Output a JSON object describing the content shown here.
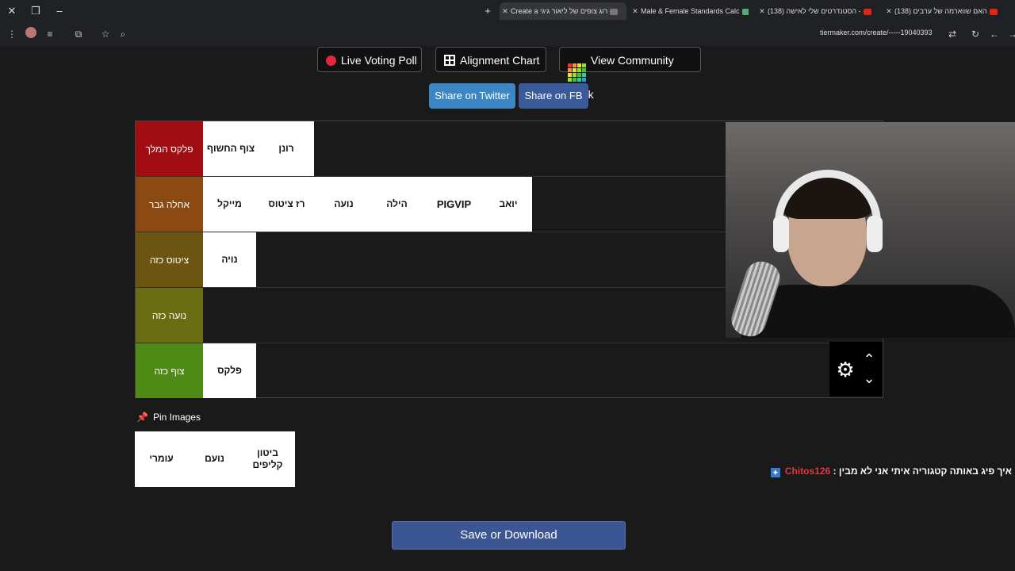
{
  "browser": {
    "tabs": [
      {
        "title": "Create a רוג צופים של ליאור גיגי",
        "active": true
      },
      {
        "title": "Male & Female Standards Calc",
        "active": false
      },
      {
        "title": "(138) הסטנדרטים שלי לאישה -",
        "active": false
      },
      {
        "title": "(138) האם שווארמה של ערבים",
        "active": false
      }
    ],
    "url": "tiermaker.com/create/-----19040393"
  },
  "top_buttons": {
    "live_poll": "Live Voting Poll",
    "alignment": "Alignment Chart",
    "community": "View Community Rank"
  },
  "share": {
    "twitter": "Share on Twitter",
    "fb": "Share on FB"
  },
  "tiers": [
    {
      "label": "פלקס המלך",
      "color": "#a20d12",
      "items": [
        "צוף החשוף",
        "רונן"
      ]
    },
    {
      "label": "אחלה גבר",
      "color": "#8a4a12",
      "items": [
        "מייקל",
        "רז ציטוס",
        "נועה",
        "הילה",
        "PIGVIP",
        "יואב"
      ]
    },
    {
      "label": "ציטוס כזה",
      "color": "#6b5510",
      "items": [
        "נויה"
      ]
    },
    {
      "label": "נועה כזה",
      "color": "#6b6d12",
      "items": []
    },
    {
      "label": "צוף כזה",
      "color": "#4f8a17",
      "items": [
        "פלקס"
      ]
    }
  ],
  "pin": {
    "label": "Pin Images",
    "items": [
      "עומרי",
      "נועם",
      "ביטון קליפים"
    ]
  },
  "chat": {
    "user": "Chitos126",
    "message": ": איך פיג באותה קטגוריה איתי אני לא מבין"
  },
  "save": "Save or Download"
}
